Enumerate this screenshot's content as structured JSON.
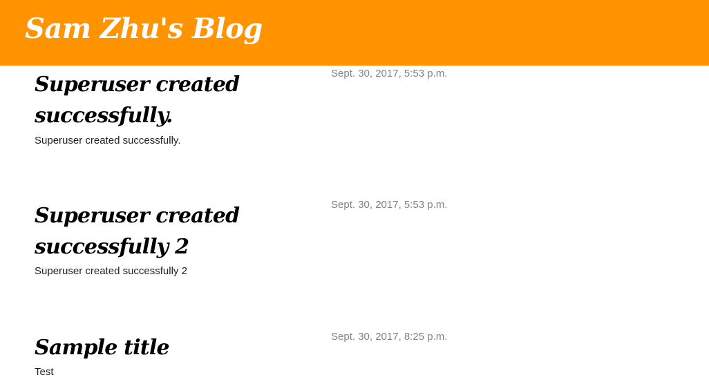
{
  "header": {
    "site_title": "Sam Zhu's Blog"
  },
  "posts": [
    {
      "date": "Sept. 30, 2017, 5:53 p.m.",
      "title": "Superuser created successfully.",
      "body": "Superuser created successfully."
    },
    {
      "date": "Sept. 30, 2017, 5:53 p.m.",
      "title": "Superuser created successfully 2",
      "body": "Superuser created successfully 2"
    },
    {
      "date": "Sept. 30, 2017, 8:25 p.m.",
      "title": "Sample title",
      "body": "Test"
    }
  ],
  "colors": {
    "header_background": "#ff9400",
    "header_text": "#ffffff",
    "date_text": "#828282"
  }
}
